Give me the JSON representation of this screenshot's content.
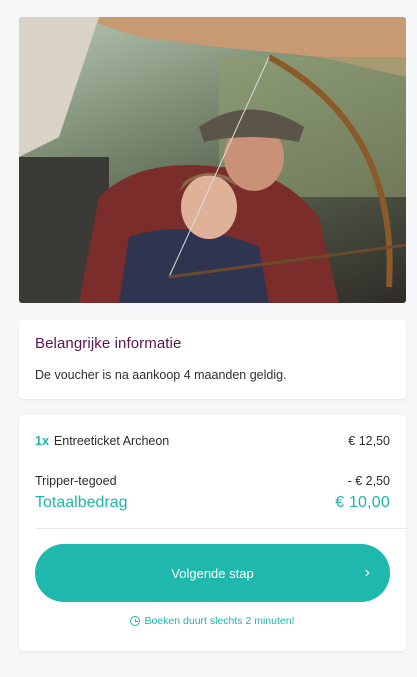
{
  "hero": {
    "image_description": "photo-archery-instructor-with-child"
  },
  "info": {
    "title": "Belangrijke informatie",
    "text": "De voucher is na aankoop 4 maanden geldig."
  },
  "order": {
    "item_qty": "1x",
    "item_name": "Entreeticket Archeon",
    "item_price": "€ 12,50",
    "credit_label": "Tripper-tegoed",
    "credit_value": "- € 2,50",
    "total_label": "Totaalbedrag",
    "total_value": "€ 10,00"
  },
  "actions": {
    "next_label": "Volgende stap",
    "hint": "Boeken duurt slechts 2 minuten!"
  },
  "colors": {
    "accent": "#1fb8ac",
    "title_purple": "#5a1450"
  }
}
